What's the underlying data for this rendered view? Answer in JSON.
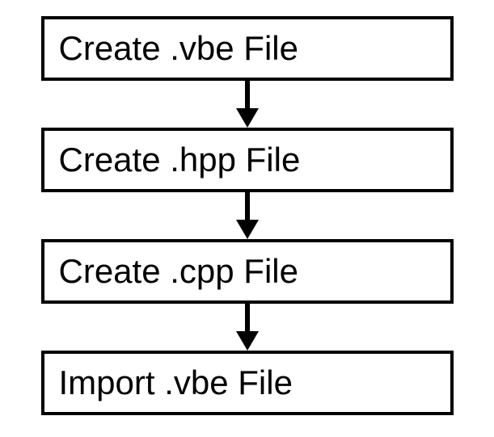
{
  "chart_data": {
    "type": "flowchart",
    "title": "",
    "steps": [
      {
        "label": "Create .vbe File"
      },
      {
        "label": "Create .hpp File"
      },
      {
        "label": "Create .cpp File"
      },
      {
        "label": "Import .vbe File"
      }
    ]
  }
}
